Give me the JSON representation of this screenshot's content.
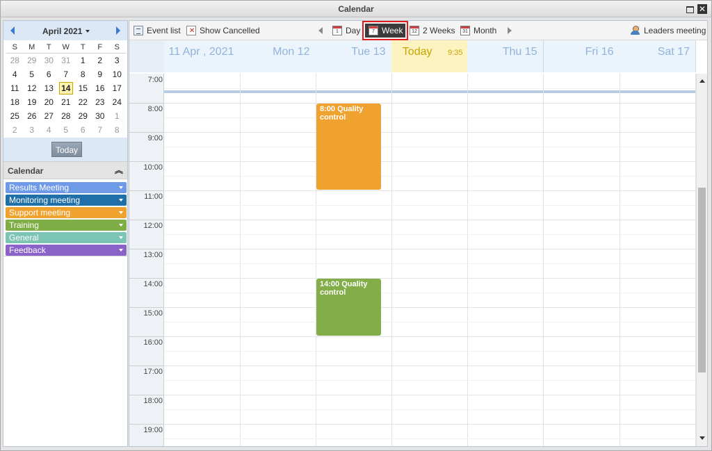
{
  "window": {
    "title": "Calendar",
    "close_label": "✕"
  },
  "mini_calendar": {
    "month_label": "April 2021",
    "weekdays": [
      "S",
      "M",
      "T",
      "W",
      "T",
      "F",
      "S"
    ],
    "weeks": [
      [
        {
          "d": "28",
          "o": true
        },
        {
          "d": "29",
          "o": true
        },
        {
          "d": "30",
          "o": true
        },
        {
          "d": "31",
          "o": true
        },
        {
          "d": "1"
        },
        {
          "d": "2"
        },
        {
          "d": "3"
        }
      ],
      [
        {
          "d": "4"
        },
        {
          "d": "5"
        },
        {
          "d": "6"
        },
        {
          "d": "7"
        },
        {
          "d": "8"
        },
        {
          "d": "9"
        },
        {
          "d": "10"
        }
      ],
      [
        {
          "d": "11"
        },
        {
          "d": "12"
        },
        {
          "d": "13"
        },
        {
          "d": "14",
          "t": true
        },
        {
          "d": "15"
        },
        {
          "d": "16"
        },
        {
          "d": "17"
        }
      ],
      [
        {
          "d": "18"
        },
        {
          "d": "19"
        },
        {
          "d": "20"
        },
        {
          "d": "21"
        },
        {
          "d": "22"
        },
        {
          "d": "23"
        },
        {
          "d": "24"
        }
      ],
      [
        {
          "d": "25"
        },
        {
          "d": "26"
        },
        {
          "d": "27"
        },
        {
          "d": "28"
        },
        {
          "d": "29"
        },
        {
          "d": "30"
        },
        {
          "d": "1",
          "o": true
        }
      ],
      [
        {
          "d": "2",
          "o": true
        },
        {
          "d": "3",
          "o": true
        },
        {
          "d": "4",
          "o": true
        },
        {
          "d": "5",
          "o": true
        },
        {
          "d": "6",
          "o": true
        },
        {
          "d": "7",
          "o": true
        },
        {
          "d": "8",
          "o": true
        }
      ]
    ],
    "today_button": "Today"
  },
  "calendars": {
    "section_title": "Calendar",
    "items": [
      {
        "label": "Results Meeting",
        "color": "#6f9ae8"
      },
      {
        "label": "Monitoring meeting",
        "color": "#1f6fa8"
      },
      {
        "label": "Support meeting",
        "color": "#f0a22e"
      },
      {
        "label": "Training",
        "color": "#7fae46"
      },
      {
        "label": "General",
        "color": "#7cc4b4"
      },
      {
        "label": "Feedback",
        "color": "#8a62c8"
      }
    ]
  },
  "toolbar": {
    "event_list": "Event list",
    "show_cancelled": "Show Cancelled",
    "day": "Day",
    "week": "Week",
    "two_weeks": "2 Weeks",
    "month": "Month",
    "leaders_meeting": "Leaders meeting",
    "day_icon_num": "1",
    "week_icon_num": "7",
    "two_weeks_icon_num": "12",
    "month_icon_num": "31"
  },
  "day_headers": [
    {
      "label": "11 Apr , 2021"
    },
    {
      "label": "Mon 12"
    },
    {
      "label": "Tue 13"
    },
    {
      "label": "Today",
      "time": "9:35",
      "today": true
    },
    {
      "label": "Thu 15"
    },
    {
      "label": "Fri 16"
    },
    {
      "label": "Sat 17"
    }
  ],
  "hours": [
    "7:00",
    "8:00",
    "9:00",
    "10:00",
    "11:00",
    "12:00",
    "13:00",
    "14:00",
    "15:00",
    "16:00",
    "17:00",
    "18:00",
    "19:00"
  ],
  "events": [
    {
      "title": "8:00 Quality control",
      "day": 2,
      "start": 8,
      "end": 11,
      "color": "#f0a22e"
    },
    {
      "title": "14:00 Quality control",
      "day": 2,
      "start": 14,
      "end": 16,
      "color": "#82ad48"
    }
  ]
}
